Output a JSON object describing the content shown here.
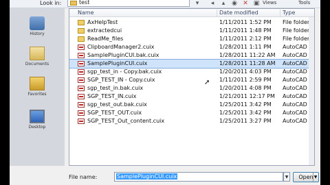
{
  "toolbar": {
    "look_in_label": "Look in:",
    "look_in_value": "test",
    "views_label": "Views",
    "tools_label": "Tools"
  },
  "places": [
    "History",
    "Documents",
    "Favorites",
    "Desktop"
  ],
  "list": {
    "columns": {
      "name": "Name",
      "date": "Date modified",
      "type": "Type"
    },
    "rows": [
      {
        "name": "AxHelpTest",
        "date": "1/11/2011 1:52 PM",
        "type": "File folder",
        "kind": "folder",
        "selected": false
      },
      {
        "name": "extractedcui",
        "date": "1/11/2011 1:48 PM",
        "type": "File folder",
        "kind": "folder",
        "selected": false
      },
      {
        "name": "ReadMe_files",
        "date": "1/11/2011 2:12 PM",
        "type": "File folder",
        "kind": "folder",
        "selected": false
      },
      {
        "name": "ClipboardManager2.cuix",
        "date": "1/28/2011 1:11 PM",
        "type": "AutoCAD Cus",
        "kind": "file",
        "selected": false
      },
      {
        "name": "SamplePluginCUI.bak.cuix",
        "date": "1/28/2011 11:22 AM",
        "type": "AutoCAD Cus",
        "kind": "file",
        "selected": false
      },
      {
        "name": "SamplePluginCUI.cuix",
        "date": "1/28/2011 11:28 AM",
        "type": "AutoCAD Cus",
        "kind": "file",
        "selected": true
      },
      {
        "name": "sgp_test_in - Copy.bak.cuix",
        "date": "1/20/2011 4:03 PM",
        "type": "AutoCAD Cus",
        "kind": "file",
        "selected": false
      },
      {
        "name": "SGP_TEST_IN - Copy.cuix",
        "date": "1/11/2011 2:59 PM",
        "type": "AutoCAD Cus",
        "kind": "file",
        "selected": false
      },
      {
        "name": "sgp_test_in.bak.cuix",
        "date": "1/20/2011 4:08 PM",
        "type": "AutoCAD Cus",
        "kind": "file",
        "selected": false
      },
      {
        "name": "SGP_TEST_IN.cuix",
        "date": "1/21/2011 12:17 PM",
        "type": "AutoCAD Cus",
        "kind": "file",
        "selected": false
      },
      {
        "name": "sgp_test_out.bak.cuix",
        "date": "1/25/2011 3:42 PM",
        "type": "AutoCAD Cus",
        "kind": "file",
        "selected": false
      },
      {
        "name": "SGP_TEST_OUT.cuix",
        "date": "1/25/2011 3:42 PM",
        "type": "AutoCAD Cus",
        "kind": "file",
        "selected": false
      },
      {
        "name": "SGP_TEST_Out_content.cuix",
        "date": "1/25/2011 3:27 PM",
        "type": "AutoCAD Cus",
        "kind": "file",
        "selected": false
      }
    ]
  },
  "bottom": {
    "file_name_label": "File name:",
    "file_name_value": "SamplePluginCUI.cuix",
    "open_label": "Open"
  }
}
